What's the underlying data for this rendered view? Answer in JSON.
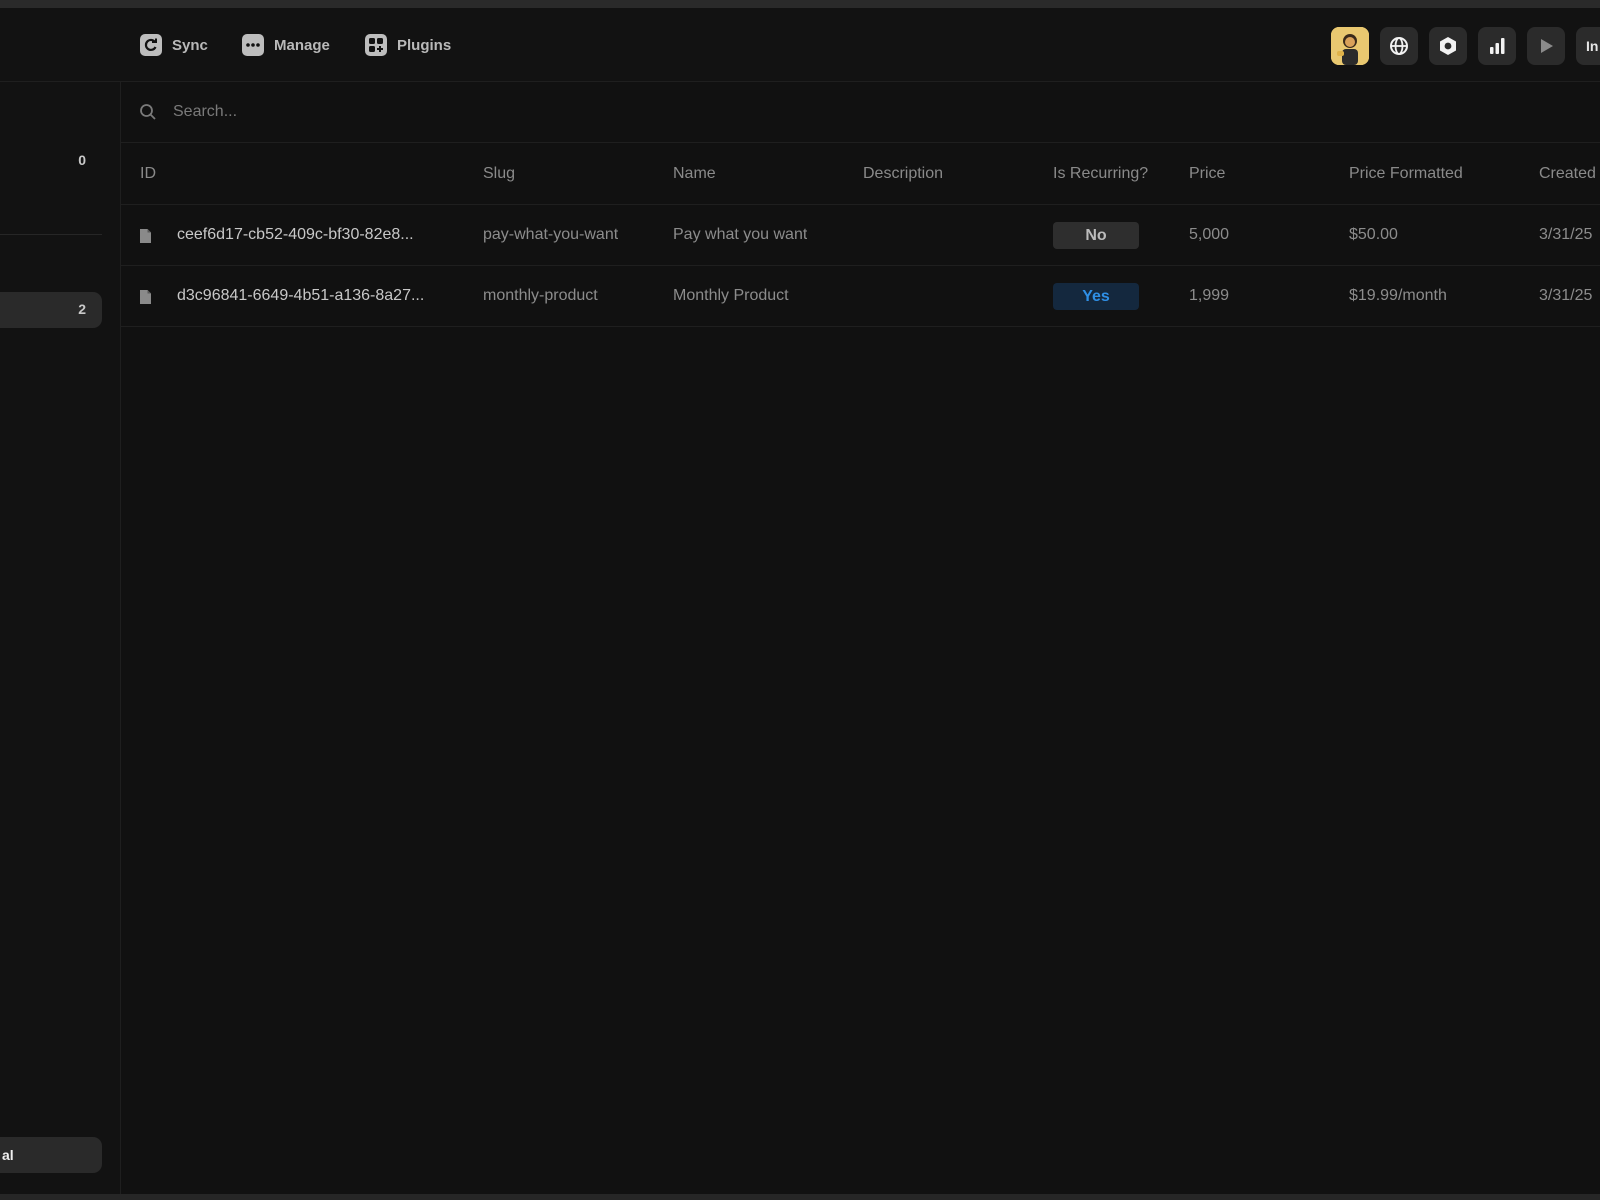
{
  "header": {
    "actions": [
      {
        "label": "Sync",
        "icon": "sync-icon"
      },
      {
        "label": "Manage",
        "icon": "more-dots-icon"
      },
      {
        "label": "Plugins",
        "icon": "plugins-icon"
      }
    ],
    "tools": [
      "avatar",
      "globe-icon",
      "hexagon-icon",
      "bar-chart-icon",
      "play-icon"
    ],
    "cut_button_label": "In"
  },
  "sidebar": {
    "top_count": "0",
    "active_item_count": "2",
    "bottom_label": "al"
  },
  "search": {
    "placeholder": "Search..."
  },
  "table": {
    "columns": [
      "ID",
      "Slug",
      "Name",
      "Description",
      "Is Recurring?",
      "Price",
      "Price Formatted",
      "Created"
    ],
    "rows": [
      {
        "id": "ceef6d17-cb52-409c-bf30-82e8...",
        "slug": "pay-what-you-want",
        "name": "Pay what you want",
        "description": "",
        "is_recurring": "No",
        "price": "5,000",
        "price_formatted": "$50.00",
        "created": "3/31/25"
      },
      {
        "id": "d3c96841-6649-4b51-a136-8a27...",
        "slug": "monthly-product",
        "name": "Monthly Product",
        "description": "",
        "is_recurring": "Yes",
        "price": "1,999",
        "price_formatted": "$19.99/month",
        "created": "3/31/25"
      }
    ]
  },
  "colors": {
    "background": "#111111",
    "badge_yes_text": "#2f8fe6",
    "badge_yes_bg": "#14283e",
    "badge_no_bg": "#2e2e2e"
  }
}
